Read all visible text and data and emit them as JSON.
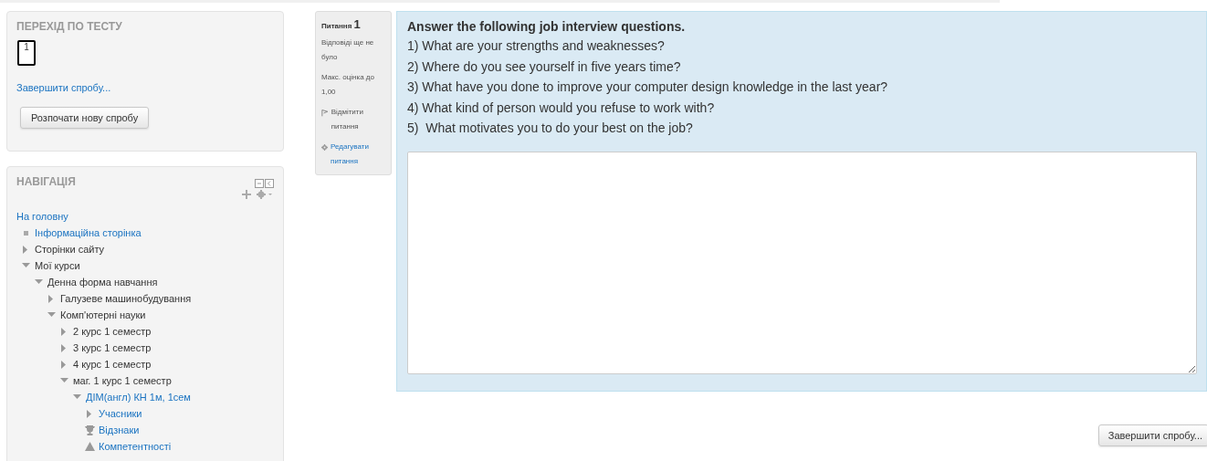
{
  "quiz_navigation": {
    "title": "ПЕРЕХІД ПО ТЕСТУ",
    "questions": [
      {
        "label": "1",
        "current": true
      }
    ],
    "finish_link": "Завершити спробу...",
    "restart_button": "Розпочати нову спробу"
  },
  "navigation": {
    "title": "НАВІГАЦІЯ",
    "home_link": "На головну",
    "tree": [
      {
        "label": "Інформаційна сторінка",
        "kind": "page",
        "link": true
      },
      {
        "label": "Сторінки сайту",
        "kind": "branch",
        "link": false,
        "expanded": false
      },
      {
        "label": "Мої курси",
        "kind": "branch",
        "link": false,
        "expanded": true,
        "children": [
          {
            "label": "Денна форма навчання",
            "kind": "branch",
            "link": false,
            "expanded": true,
            "children": [
              {
                "label": "Галузеве машинобудування",
                "kind": "branch",
                "link": false,
                "expanded": false
              },
              {
                "label": "Комп'ютерні науки",
                "kind": "branch",
                "link": false,
                "expanded": true,
                "children": [
                  {
                    "label": "2 курс 1 семестр",
                    "kind": "branch",
                    "link": false,
                    "expanded": false
                  },
                  {
                    "label": "3 курс 1 семестр",
                    "kind": "branch",
                    "link": false,
                    "expanded": false
                  },
                  {
                    "label": "4 курс 1 семестр",
                    "kind": "branch",
                    "link": false,
                    "expanded": false
                  },
                  {
                    "label": "маг. 1 курс 1 семестр",
                    "kind": "branch",
                    "link": false,
                    "expanded": true,
                    "children": [
                      {
                        "label": "ДІМ(англ) КН 1м, 1сем",
                        "kind": "branch",
                        "link": true,
                        "expanded": true,
                        "children": [
                          {
                            "label": "Учасники",
                            "kind": "branch",
                            "link": true,
                            "expanded": false
                          },
                          {
                            "label": "Відзнаки",
                            "kind": "badges",
                            "link": true
                          },
                          {
                            "label": "Компетентності",
                            "kind": "competencies",
                            "link": true
                          }
                        ]
                      }
                    ]
                  }
                ]
              }
            ]
          }
        ]
      }
    ]
  },
  "question_info": {
    "label": "Питання",
    "number": "1",
    "status": "Відповіді ще не було",
    "mark": "Макс. оцінка до 1,00",
    "flag_link": "Відмітити питання",
    "edit_link": "Редагувати питання"
  },
  "question": {
    "heading": "Answer the following job interview questions.",
    "lines": [
      "1) What are your strengths and weaknesses?",
      "2) Where do you see yourself in five years time?",
      "3) What have you done to improve your computer design knowledge in the last year?",
      "4) What kind of person would you refuse to work with?",
      "5)  What motivates you to do your best on the job?"
    ]
  },
  "finish_button": "Завершити спробу..."
}
